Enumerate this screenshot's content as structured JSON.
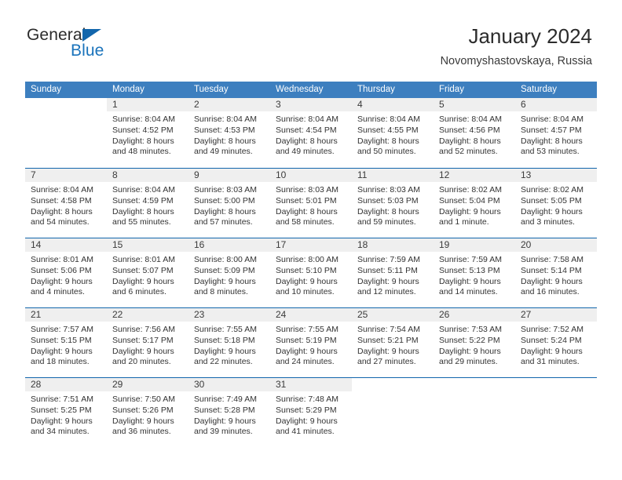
{
  "brand": {
    "word_one": "General",
    "word_two": "Blue",
    "triangle_icon": "blue-triangle-icon",
    "accent_color": "#1266ac"
  },
  "header": {
    "title": "January 2024",
    "subtitle": "Novomyshastovskaya, Russia"
  },
  "colors": {
    "header_blue": "#3d7fbf",
    "separator_blue": "#1266ac",
    "daynum_band": "#efefef",
    "text": "#333333"
  },
  "weekdays": [
    "Sunday",
    "Monday",
    "Tuesday",
    "Wednesday",
    "Thursday",
    "Friday",
    "Saturday"
  ],
  "labels": {
    "sunrise": "Sunrise:",
    "sunset": "Sunset:",
    "daylight": "Daylight:"
  },
  "weeks": [
    [
      {
        "empty": true
      },
      {
        "day": "1",
        "sunrise": "Sunrise: 8:04 AM",
        "sunset": "Sunset: 4:52 PM",
        "daylight1": "Daylight: 8 hours",
        "daylight2": "and 48 minutes."
      },
      {
        "day": "2",
        "sunrise": "Sunrise: 8:04 AM",
        "sunset": "Sunset: 4:53 PM",
        "daylight1": "Daylight: 8 hours",
        "daylight2": "and 49 minutes."
      },
      {
        "day": "3",
        "sunrise": "Sunrise: 8:04 AM",
        "sunset": "Sunset: 4:54 PM",
        "daylight1": "Daylight: 8 hours",
        "daylight2": "and 49 minutes."
      },
      {
        "day": "4",
        "sunrise": "Sunrise: 8:04 AM",
        "sunset": "Sunset: 4:55 PM",
        "daylight1": "Daylight: 8 hours",
        "daylight2": "and 50 minutes."
      },
      {
        "day": "5",
        "sunrise": "Sunrise: 8:04 AM",
        "sunset": "Sunset: 4:56 PM",
        "daylight1": "Daylight: 8 hours",
        "daylight2": "and 52 minutes."
      },
      {
        "day": "6",
        "sunrise": "Sunrise: 8:04 AM",
        "sunset": "Sunset: 4:57 PM",
        "daylight1": "Daylight: 8 hours",
        "daylight2": "and 53 minutes."
      }
    ],
    [
      {
        "day": "7",
        "sunrise": "Sunrise: 8:04 AM",
        "sunset": "Sunset: 4:58 PM",
        "daylight1": "Daylight: 8 hours",
        "daylight2": "and 54 minutes."
      },
      {
        "day": "8",
        "sunrise": "Sunrise: 8:04 AM",
        "sunset": "Sunset: 4:59 PM",
        "daylight1": "Daylight: 8 hours",
        "daylight2": "and 55 minutes."
      },
      {
        "day": "9",
        "sunrise": "Sunrise: 8:03 AM",
        "sunset": "Sunset: 5:00 PM",
        "daylight1": "Daylight: 8 hours",
        "daylight2": "and 57 minutes."
      },
      {
        "day": "10",
        "sunrise": "Sunrise: 8:03 AM",
        "sunset": "Sunset: 5:01 PM",
        "daylight1": "Daylight: 8 hours",
        "daylight2": "and 58 minutes."
      },
      {
        "day": "11",
        "sunrise": "Sunrise: 8:03 AM",
        "sunset": "Sunset: 5:03 PM",
        "daylight1": "Daylight: 8 hours",
        "daylight2": "and 59 minutes."
      },
      {
        "day": "12",
        "sunrise": "Sunrise: 8:02 AM",
        "sunset": "Sunset: 5:04 PM",
        "daylight1": "Daylight: 9 hours",
        "daylight2": "and 1 minute."
      },
      {
        "day": "13",
        "sunrise": "Sunrise: 8:02 AM",
        "sunset": "Sunset: 5:05 PM",
        "daylight1": "Daylight: 9 hours",
        "daylight2": "and 3 minutes."
      }
    ],
    [
      {
        "day": "14",
        "sunrise": "Sunrise: 8:01 AM",
        "sunset": "Sunset: 5:06 PM",
        "daylight1": "Daylight: 9 hours",
        "daylight2": "and 4 minutes."
      },
      {
        "day": "15",
        "sunrise": "Sunrise: 8:01 AM",
        "sunset": "Sunset: 5:07 PM",
        "daylight1": "Daylight: 9 hours",
        "daylight2": "and 6 minutes."
      },
      {
        "day": "16",
        "sunrise": "Sunrise: 8:00 AM",
        "sunset": "Sunset: 5:09 PM",
        "daylight1": "Daylight: 9 hours",
        "daylight2": "and 8 minutes."
      },
      {
        "day": "17",
        "sunrise": "Sunrise: 8:00 AM",
        "sunset": "Sunset: 5:10 PM",
        "daylight1": "Daylight: 9 hours",
        "daylight2": "and 10 minutes."
      },
      {
        "day": "18",
        "sunrise": "Sunrise: 7:59 AM",
        "sunset": "Sunset: 5:11 PM",
        "daylight1": "Daylight: 9 hours",
        "daylight2": "and 12 minutes."
      },
      {
        "day": "19",
        "sunrise": "Sunrise: 7:59 AM",
        "sunset": "Sunset: 5:13 PM",
        "daylight1": "Daylight: 9 hours",
        "daylight2": "and 14 minutes."
      },
      {
        "day": "20",
        "sunrise": "Sunrise: 7:58 AM",
        "sunset": "Sunset: 5:14 PM",
        "daylight1": "Daylight: 9 hours",
        "daylight2": "and 16 minutes."
      }
    ],
    [
      {
        "day": "21",
        "sunrise": "Sunrise: 7:57 AM",
        "sunset": "Sunset: 5:15 PM",
        "daylight1": "Daylight: 9 hours",
        "daylight2": "and 18 minutes."
      },
      {
        "day": "22",
        "sunrise": "Sunrise: 7:56 AM",
        "sunset": "Sunset: 5:17 PM",
        "daylight1": "Daylight: 9 hours",
        "daylight2": "and 20 minutes."
      },
      {
        "day": "23",
        "sunrise": "Sunrise: 7:55 AM",
        "sunset": "Sunset: 5:18 PM",
        "daylight1": "Daylight: 9 hours",
        "daylight2": "and 22 minutes."
      },
      {
        "day": "24",
        "sunrise": "Sunrise: 7:55 AM",
        "sunset": "Sunset: 5:19 PM",
        "daylight1": "Daylight: 9 hours",
        "daylight2": "and 24 minutes."
      },
      {
        "day": "25",
        "sunrise": "Sunrise: 7:54 AM",
        "sunset": "Sunset: 5:21 PM",
        "daylight1": "Daylight: 9 hours",
        "daylight2": "and 27 minutes."
      },
      {
        "day": "26",
        "sunrise": "Sunrise: 7:53 AM",
        "sunset": "Sunset: 5:22 PM",
        "daylight1": "Daylight: 9 hours",
        "daylight2": "and 29 minutes."
      },
      {
        "day": "27",
        "sunrise": "Sunrise: 7:52 AM",
        "sunset": "Sunset: 5:24 PM",
        "daylight1": "Daylight: 9 hours",
        "daylight2": "and 31 minutes."
      }
    ],
    [
      {
        "day": "28",
        "sunrise": "Sunrise: 7:51 AM",
        "sunset": "Sunset: 5:25 PM",
        "daylight1": "Daylight: 9 hours",
        "daylight2": "and 34 minutes."
      },
      {
        "day": "29",
        "sunrise": "Sunrise: 7:50 AM",
        "sunset": "Sunset: 5:26 PM",
        "daylight1": "Daylight: 9 hours",
        "daylight2": "and 36 minutes."
      },
      {
        "day": "30",
        "sunrise": "Sunrise: 7:49 AM",
        "sunset": "Sunset: 5:28 PM",
        "daylight1": "Daylight: 9 hours",
        "daylight2": "and 39 minutes."
      },
      {
        "day": "31",
        "sunrise": "Sunrise: 7:48 AM",
        "sunset": "Sunset: 5:29 PM",
        "daylight1": "Daylight: 9 hours",
        "daylight2": "and 41 minutes."
      },
      {
        "empty": true
      },
      {
        "empty": true
      },
      {
        "empty": true
      }
    ]
  ]
}
